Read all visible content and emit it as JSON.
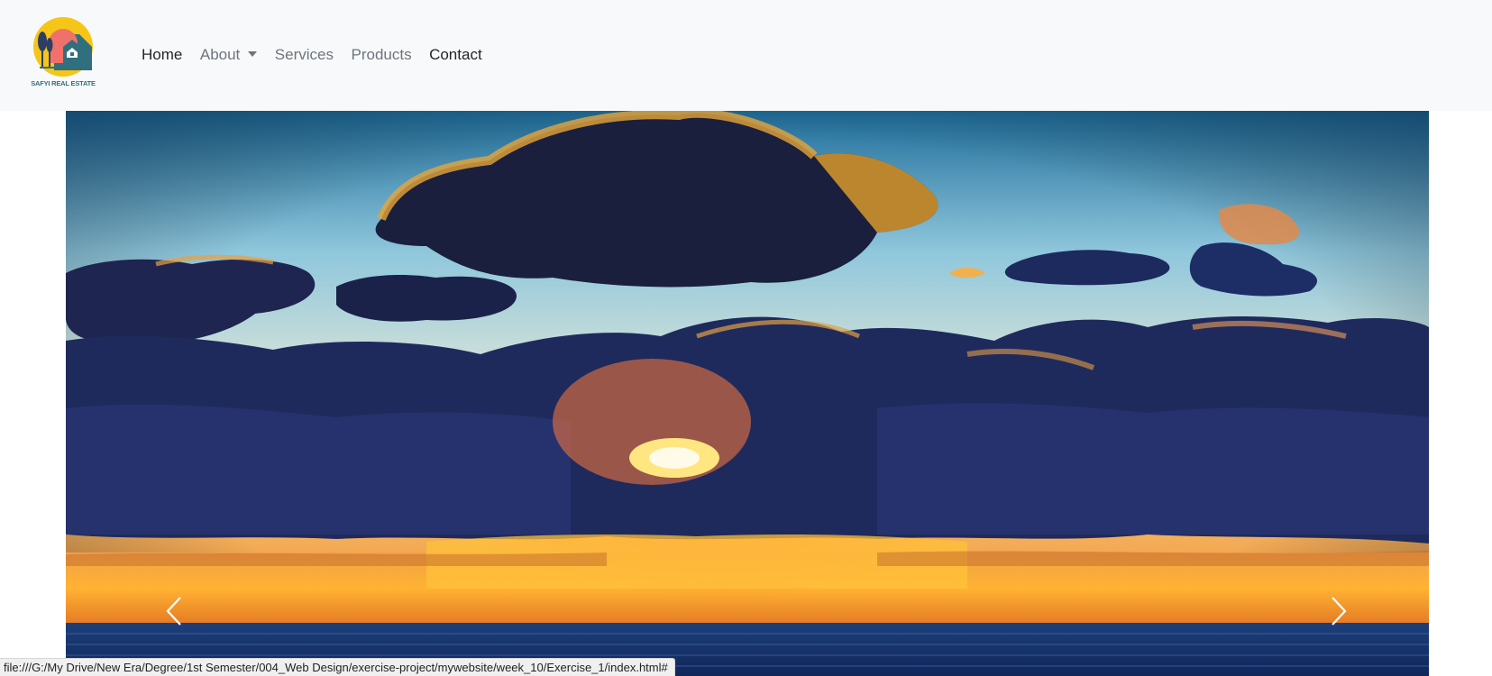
{
  "brand": {
    "logo_text": "SAFYI REAL ESTATE",
    "logo_icon": "house-trees-logo"
  },
  "nav": {
    "items": [
      {
        "label": "Home",
        "state": "active"
      },
      {
        "label": "About",
        "state": "dropdown"
      },
      {
        "label": "Services",
        "state": "muted"
      },
      {
        "label": "Products",
        "state": "muted"
      },
      {
        "label": "Contact",
        "state": "dark"
      }
    ]
  },
  "carousel": {
    "image_subject": "sunset-over-sea-with-clouds",
    "prev_icon": "chevron-left-icon",
    "next_icon": "chevron-right-icon"
  },
  "status": {
    "url": "file:///G:/My Drive/New Era/Degree/1st Semester/004_Web Design/exercise-project/mywebsite/week_10/Exercise_1/index.html#"
  },
  "colors": {
    "navbar_bg": "#f8f9fa",
    "nav_active": "#212529",
    "nav_muted": "#6c757d",
    "logo_yellow": "#f5c518",
    "logo_teal": "#2f6f7e",
    "logo_coral": "#f0716a"
  }
}
